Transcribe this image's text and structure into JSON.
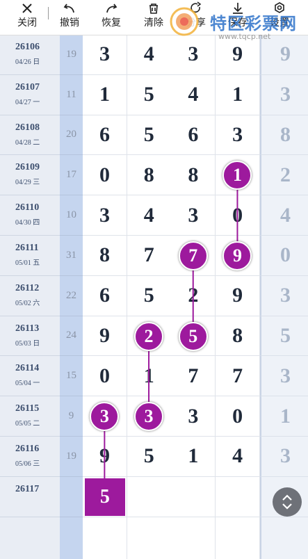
{
  "toolbar": {
    "items": [
      {
        "label": "关闭",
        "icon": "close-icon"
      },
      {
        "label": "撤销",
        "icon": "undo-icon"
      },
      {
        "label": "恢复",
        "icon": "redo-icon"
      },
      {
        "label": "清除",
        "icon": "trash-icon"
      },
      {
        "label": "分享",
        "icon": "share-icon"
      },
      {
        "label": "保存",
        "icon": "download-icon"
      },
      {
        "label": "设置",
        "icon": "settings-icon"
      }
    ]
  },
  "watermark": {
    "text": "特区彩票网",
    "url": "www.tqcp.net"
  },
  "rows": [
    {
      "issue": "26106",
      "date": "04/26 日",
      "sum": "19",
      "digits": [
        "3",
        "4",
        "3",
        "9"
      ],
      "extra": "9"
    },
    {
      "issue": "26107",
      "date": "04/27 一",
      "sum": "11",
      "digits": [
        "1",
        "5",
        "4",
        "1"
      ],
      "extra": "3"
    },
    {
      "issue": "26108",
      "date": "04/28 二",
      "sum": "20",
      "digits": [
        "6",
        "5",
        "6",
        "3"
      ],
      "extra": "8"
    },
    {
      "issue": "26109",
      "date": "04/29 三",
      "sum": "17",
      "digits": [
        "0",
        "8",
        "8",
        "1"
      ],
      "extra": "2"
    },
    {
      "issue": "26110",
      "date": "04/30 四",
      "sum": "10",
      "digits": [
        "3",
        "4",
        "3",
        "0"
      ],
      "extra": "4"
    },
    {
      "issue": "26111",
      "date": "05/01 五",
      "sum": "31",
      "digits": [
        "8",
        "7",
        "7",
        "9"
      ],
      "extra": "0"
    },
    {
      "issue": "26112",
      "date": "05/02 六",
      "sum": "22",
      "digits": [
        "6",
        "5",
        "2",
        "9"
      ],
      "extra": "3"
    },
    {
      "issue": "26113",
      "date": "05/03 日",
      "sum": "24",
      "digits": [
        "9",
        "2",
        "5",
        "8"
      ],
      "extra": "5"
    },
    {
      "issue": "26114",
      "date": "05/04 一",
      "sum": "15",
      "digits": [
        "0",
        "1",
        "7",
        "7"
      ],
      "extra": "3"
    },
    {
      "issue": "26115",
      "date": "05/05 二",
      "sum": "9",
      "digits": [
        "3",
        "3",
        "3",
        "0"
      ],
      "extra": "1"
    },
    {
      "issue": "26116",
      "date": "05/06 三",
      "sum": "19",
      "digits": [
        "9",
        "5",
        "1",
        "4"
      ],
      "extra": "3"
    },
    {
      "issue": "26117",
      "date": "",
      "sum": "",
      "digits": [
        "5",
        "",
        "",
        ""
      ],
      "extra": ""
    }
  ],
  "balls": [
    {
      "row": 3,
      "col": 3
    },
    {
      "row": 5,
      "col": 2
    },
    {
      "row": 5,
      "col": 3
    },
    {
      "row": 7,
      "col": 1
    },
    {
      "row": 7,
      "col": 2
    },
    {
      "row": 9,
      "col": 0
    },
    {
      "row": 9,
      "col": 1
    },
    {
      "row": 11,
      "col": 0,
      "shape": "square"
    }
  ],
  "links": [
    [
      3,
      3,
      5,
      3
    ],
    [
      5,
      2,
      7,
      2
    ],
    [
      7,
      1,
      9,
      1
    ],
    [
      9,
      0,
      11,
      0
    ]
  ],
  "colors": {
    "ball": "#9d1a9d",
    "line": "#9d1a9d",
    "sum_column": "#c5d5ef",
    "label_column": "#e9edf4"
  }
}
